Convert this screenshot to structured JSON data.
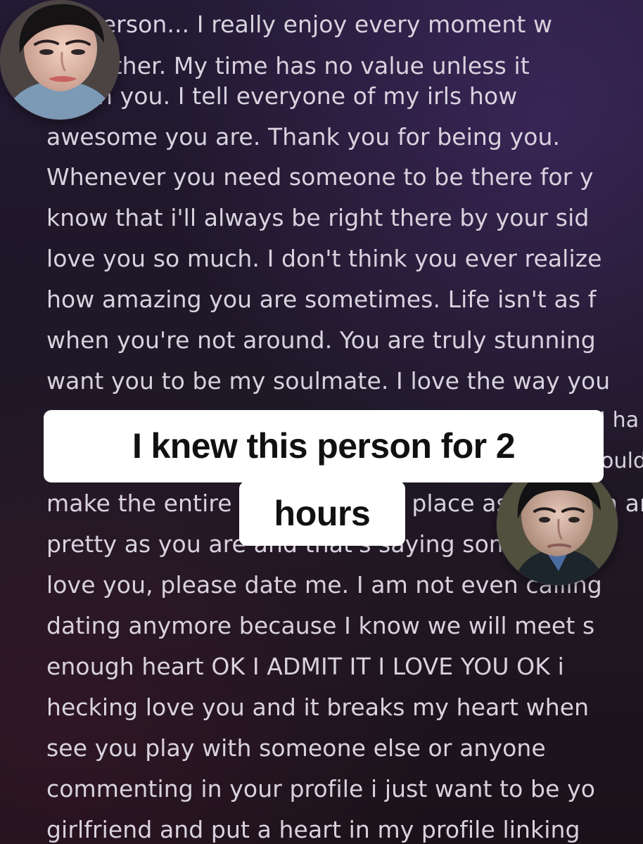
{
  "body_lines": [
    "ter person... I really enjoy every moment w",
    "l together. My time has no value unless it",
    "t with you. I tell everyone of my irls how",
    "awesome you are. Thank you for being you.",
    "Whenever you need someone to be there for y",
    "know that i'll always be right there by your sid",
    "love you so much. I don't think you ever realize",
    "how amazing you are sometimes. Life isn't as f",
    "when you're not around. You are truly stunning",
    "want you to be my soulmate. I love the way you",
    "make the entire world a better place as a person and you're as",
    "pretty as you are and that's saying something.",
    "love you, please date me. I am not even calling",
    "dating anymore because I know we will meet s",
    "enough heart OK I ADMIT IT I LOVE YOU OK i",
    "hecking love you and it breaks my heart when",
    "see you play with someone else or anyone",
    "commenting in your profile i just want to be yo",
    "girlfriend and put a heart in my profile linking"
  ],
  "partial_fragments": {
    "top_right_hidden": "I ha",
    "middle_right_hidden": "ould"
  },
  "caption": {
    "line1": "I knew this person for 2",
    "line2": "hours"
  }
}
